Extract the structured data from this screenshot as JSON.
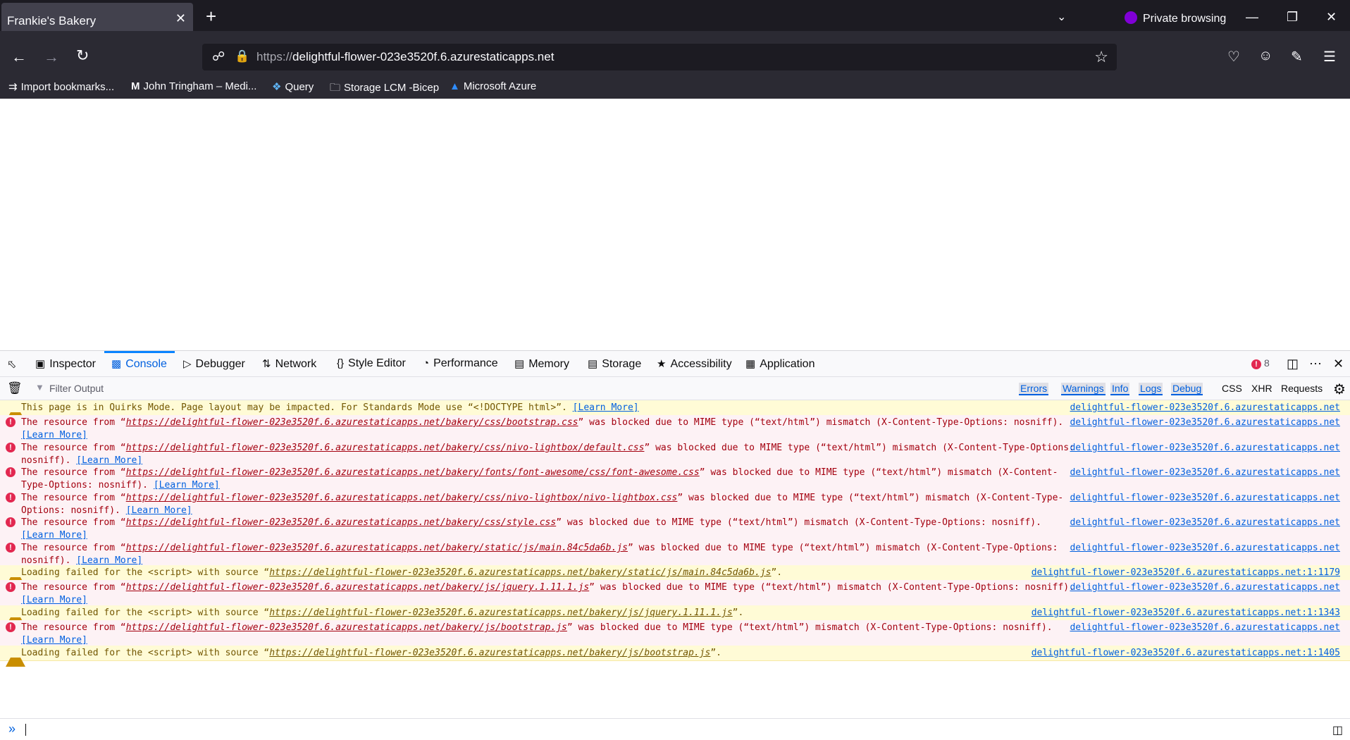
{
  "browser": {
    "tab_title": "Frankie's Bakery",
    "tab_close": "✕",
    "new_tab": "+",
    "list_tabs_icon": "chevron-down-icon",
    "private_label": "Private browsing",
    "url_scheme": "https://",
    "url_host": "delightful-flower-023e3520f.6.azurestaticapps.net",
    "bookmarks": [
      "Import bookmarks...",
      "John Tringham – Medi...",
      "Query",
      "Storage LCM -Bicep",
      "Microsoft Azure"
    ]
  },
  "devtools": {
    "tabs": [
      "Inspector",
      "Console",
      "Debugger",
      "Network",
      "Style Editor",
      "Performance",
      "Memory",
      "Storage",
      "Accessibility",
      "Application"
    ],
    "active_tab": "Console",
    "error_count": "8",
    "filter_placeholder": "Filter Output",
    "filters": [
      "Errors",
      "Warnings",
      "Info",
      "Logs",
      "Debug"
    ],
    "filters_extra": [
      "CSS",
      "XHR",
      "Requests"
    ]
  },
  "console": {
    "messages": [
      {
        "level": "warning",
        "pre": "This page is in Quirks Mode. Page layout may be impacted. For Standards Mode use “<!DOCTYPE html>”. ",
        "url": "",
        "post": "",
        "learn": "[Learn More]",
        "source": "delightful-flower-023e3520f.6.azurestaticapps.net"
      },
      {
        "level": "error",
        "pre": "The resource from “",
        "url": "https://delightful-flower-023e3520f.6.azurestaticapps.net/bakery/css/bootstrap.css",
        "post": "” was blocked due to MIME type (“text/html”) mismatch (X-Content-Type-Options: nosniff). ",
        "learn": "[Learn More]",
        "source": "delightful-flower-023e3520f.6.azurestaticapps.net"
      },
      {
        "level": "error",
        "pre": "The resource from “",
        "url": "https://delightful-flower-023e3520f.6.azurestaticapps.net/bakery/css/nivo-lightbox/default.css",
        "post": "” was blocked due to MIME type (“text/html”) mismatch (X-Content-Type-Options: nosniff). ",
        "learn": "[Learn More]",
        "source": "delightful-flower-023e3520f.6.azurestaticapps.net"
      },
      {
        "level": "error",
        "pre": "The resource from “",
        "url": "https://delightful-flower-023e3520f.6.azurestaticapps.net/bakery/fonts/font-awesome/css/font-awesome.css",
        "post": "” was blocked due to MIME type (“text/html”) mismatch (X-Content-Type-Options: nosniff). ",
        "learn": "[Learn More]",
        "source": "delightful-flower-023e3520f.6.azurestaticapps.net"
      },
      {
        "level": "error",
        "pre": "The resource from “",
        "url": "https://delightful-flower-023e3520f.6.azurestaticapps.net/bakery/css/nivo-lightbox/nivo-lightbox.css",
        "post": "” was blocked due to MIME type (“text/html”) mismatch (X-Content-Type-Options: nosniff). ",
        "learn": "[Learn More]",
        "source": "delightful-flower-023e3520f.6.azurestaticapps.net"
      },
      {
        "level": "error",
        "pre": "The resource from “",
        "url": "https://delightful-flower-023e3520f.6.azurestaticapps.net/bakery/css/style.css",
        "post": "” was blocked due to MIME type (“text/html”) mismatch (X-Content-Type-Options: nosniff). ",
        "learn": "[Learn More]",
        "source": "delightful-flower-023e3520f.6.azurestaticapps.net"
      },
      {
        "level": "error",
        "pre": "The resource from “",
        "url": "https://delightful-flower-023e3520f.6.azurestaticapps.net/bakery/static/js/main.84c5da6b.js",
        "post": "” was blocked due to MIME type (“text/html”) mismatch (X-Content-Type-Options: nosniff). ",
        "learn": "[Learn More]",
        "source": "delightful-flower-023e3520f.6.azurestaticapps.net"
      },
      {
        "level": "warning",
        "pre": "Loading failed for the <script> with source “",
        "url": "https://delightful-flower-023e3520f.6.azurestaticapps.net/bakery/static/js/main.84c5da6b.js",
        "post": "”.",
        "learn": "",
        "source": "delightful-flower-023e3520f.6.azurestaticapps.net:1:1179"
      },
      {
        "level": "error",
        "pre": "The resource from “",
        "url": "https://delightful-flower-023e3520f.6.azurestaticapps.net/bakery/js/jquery.1.11.1.js",
        "post": "” was blocked due to MIME type (“text/html”) mismatch (X-Content-Type-Options: nosniff). ",
        "learn": "[Learn More]",
        "source": "delightful-flower-023e3520f.6.azurestaticapps.net"
      },
      {
        "level": "warning",
        "pre": "Loading failed for the <script> with source “",
        "url": "https://delightful-flower-023e3520f.6.azurestaticapps.net/bakery/js/jquery.1.11.1.js",
        "post": "”.",
        "learn": "",
        "source": "delightful-flower-023e3520f.6.azurestaticapps.net:1:1343"
      },
      {
        "level": "error",
        "pre": "The resource from “",
        "url": "https://delightful-flower-023e3520f.6.azurestaticapps.net/bakery/js/bootstrap.js",
        "post": "” was blocked due to MIME type (“text/html”) mismatch (X-Content-Type-Options: nosniff). ",
        "learn": "[Learn More]",
        "source": "delightful-flower-023e3520f.6.azurestaticapps.net"
      },
      {
        "level": "warning",
        "pre": "Loading failed for the <script> with source “",
        "url": "https://delightful-flower-023e3520f.6.azurestaticapps.net/bakery/js/bootstrap.js",
        "post": "”.",
        "learn": "",
        "source": "delightful-flower-023e3520f.6.azurestaticapps.net:1:1405"
      }
    ]
  },
  "colors": {
    "error": "#e22850",
    "warning": "#c98e00",
    "accent": "#0060df"
  }
}
